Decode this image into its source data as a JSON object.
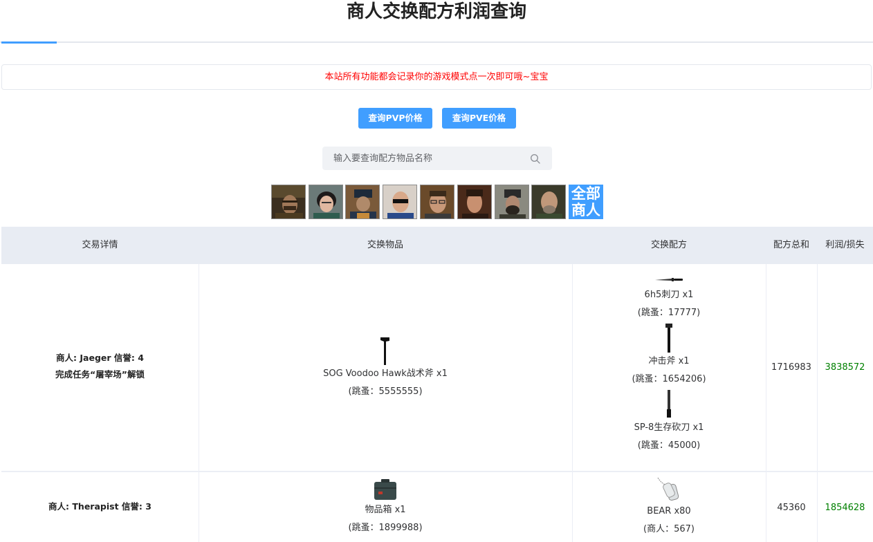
{
  "page": {
    "title": "商人交换配方利润查询"
  },
  "notice": {
    "text": "本站所有功能都会记录你的游戏模式点一次即可哦~宝宝"
  },
  "buttons": {
    "pvp": "查询PVP价格",
    "pve": "查询PVE价格"
  },
  "search": {
    "placeholder": "输入要查询配方物品名称"
  },
  "traders": {
    "avatars": [
      "prapor-avatar",
      "therapist-avatar",
      "fence-avatar",
      "skier-avatar",
      "peacekeeper-avatar",
      "mechanic-avatar",
      "ragman-avatar",
      "jaeger-avatar"
    ],
    "all_label_line1": "全部",
    "all_label_line2": "商人"
  },
  "table": {
    "headers": {
      "detail": "交易详情",
      "item": "交换物品",
      "recipe": "交换配方",
      "total": "配方总和",
      "profit": "利润/损失"
    },
    "rows": [
      {
        "detail_line1": "商人: Jaeger 信誉: 4",
        "detail_line2": "完成任务“屠宰场”解锁",
        "item": {
          "name": "SOG Voodoo Hawk战术斧 x1",
          "price": "(跳蚤：5555555)",
          "icon": "tomahawk-icon"
        },
        "recipe": [
          {
            "name": "6h5刺刀 x1",
            "price": "(跳蚤：17777)",
            "icon": "bayonet-icon"
          },
          {
            "name": "冲击斧 x1",
            "price": "(跳蚤：1654206)",
            "icon": "axe-icon"
          },
          {
            "name": "SP-8生存砍刀 x1",
            "price": "(跳蚤：45000)",
            "icon": "machete-icon"
          }
        ],
        "total": "1716983",
        "profit": "3838572"
      },
      {
        "detail_line1": "商人: Therapist 信誉: 3",
        "item": {
          "name": "物品箱 x1",
          "price": "(跳蚤：1899988)",
          "icon": "item-case-icon"
        },
        "recipe": [
          {
            "name": "BEAR x80",
            "price": "(商人：567)",
            "icon": "dogtag-icon"
          }
        ],
        "total": "45360",
        "profit": "1854628"
      }
    ]
  },
  "colors": {
    "accent": "#409eff",
    "notice": "#ff0000",
    "profit": "#008000",
    "header_bg": "#e8ecf3"
  }
}
